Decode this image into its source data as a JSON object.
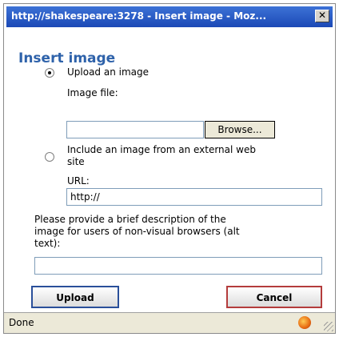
{
  "window": {
    "title": "http://shakespeare:3278 - Insert image - Moz...",
    "close_icon": "close-icon"
  },
  "dialog": {
    "title": "Insert image",
    "upload_option": {
      "label": "Upload an image",
      "selected": true
    },
    "image_file": {
      "label": "Image file:",
      "value": "",
      "browse_label": "Browse..."
    },
    "external_option": {
      "label_line1": "Include an image from an external web",
      "label_line2": "site",
      "selected": false
    },
    "url": {
      "label": "URL:",
      "value": "http://"
    },
    "alt": {
      "label_line1": "Please provide a brief description of the",
      "label_line2": "image for users of non-visual browsers (alt",
      "label_line3": "text):",
      "value": ""
    },
    "buttons": {
      "upload": "Upload",
      "cancel": "Cancel"
    }
  },
  "statusbar": {
    "text": "Done",
    "icon": "firefox-icon"
  }
}
